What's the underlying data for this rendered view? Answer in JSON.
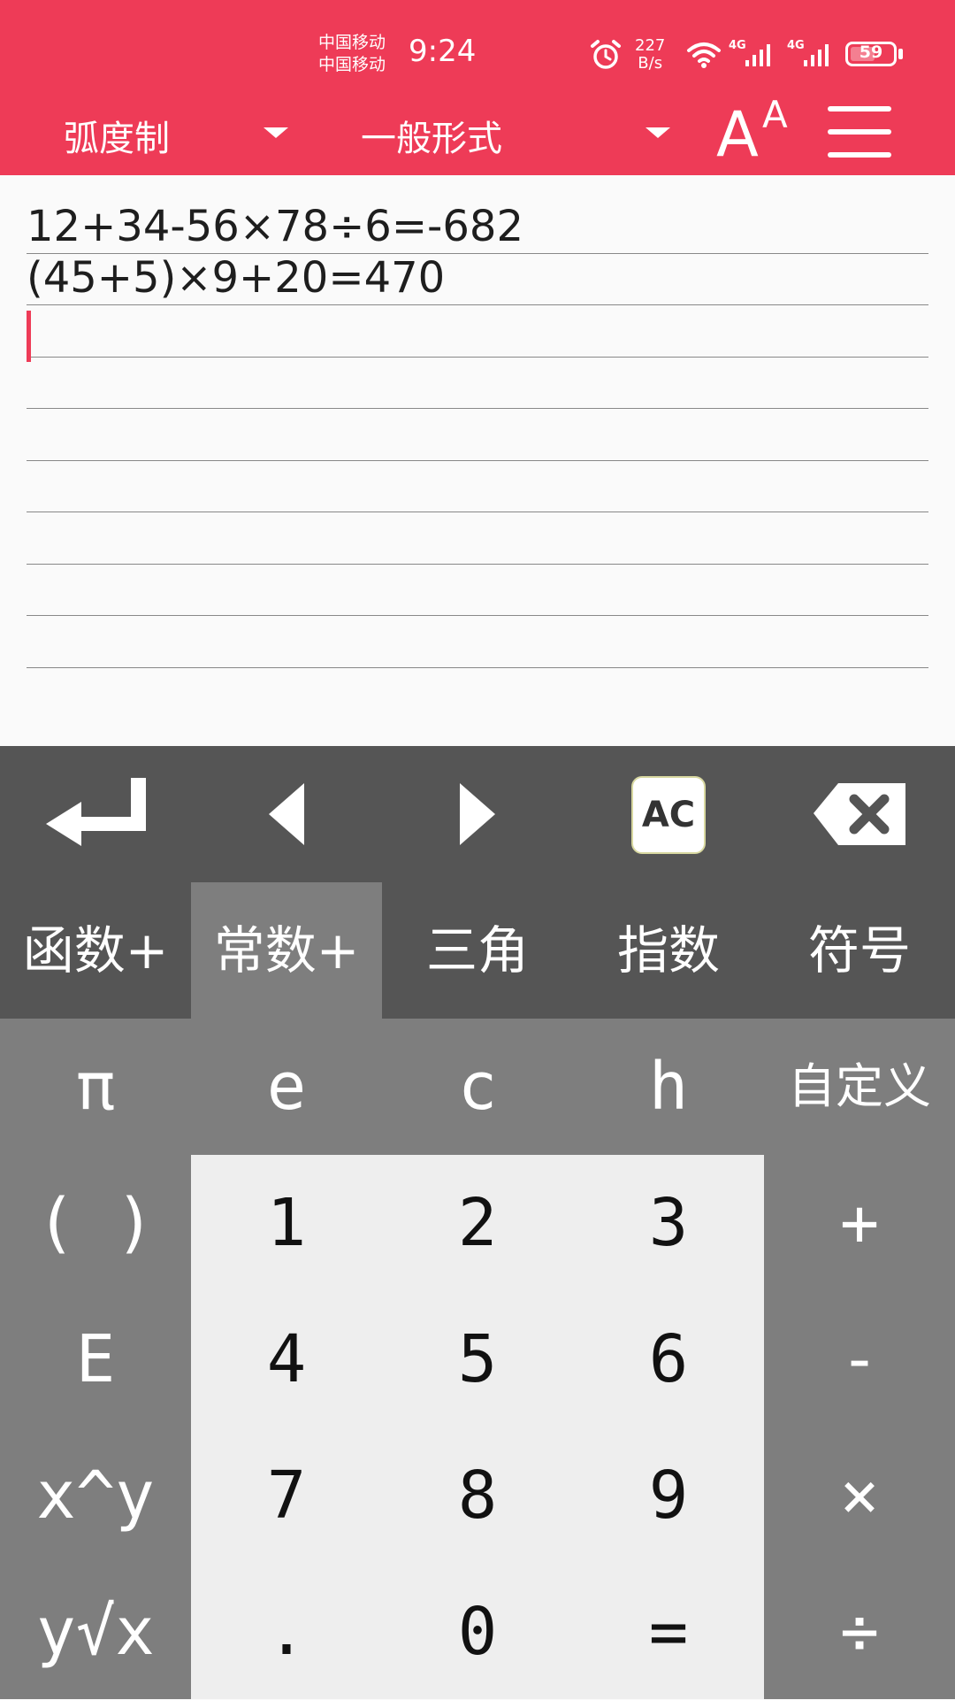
{
  "status_bar": {
    "carrier_1": "中国移动",
    "carrier_2": "中国移动",
    "time": "9:24",
    "speed_value": "227",
    "speed_unit": "B/s",
    "signal_1_label": "4G",
    "signal_2_label": "4G",
    "battery": "59",
    "battery_level": 0.59
  },
  "toolbar": {
    "angle_mode": "弧度制",
    "display_format": "一般形式",
    "font_size_icon": "font-size-icon",
    "menu_icon": "menu-icon"
  },
  "editor": {
    "lines": [
      "12+34-56×78÷6=-682",
      "(45+5)×9+20=470",
      "",
      "",
      "",
      "",
      "",
      "",
      "",
      ""
    ],
    "cursor_line": 2
  },
  "controls": {
    "enter_icon": "enter-icon",
    "left_icon": "arrow-left-icon",
    "right_icon": "arrow-right-icon",
    "clear_label": "AC",
    "backspace_icon": "backspace-icon"
  },
  "tabs": {
    "items": [
      "函数+",
      "常数+",
      "三角",
      "指数",
      "符号"
    ],
    "active": 1
  },
  "keypad": {
    "row1": [
      "π",
      "e",
      "c",
      "h",
      "自定义"
    ],
    "row2": [
      "( )",
      "1",
      "2",
      "3",
      "+"
    ],
    "row3": [
      "E",
      "4",
      "5",
      "6",
      "-"
    ],
    "row4": [
      "x^y",
      "7",
      "8",
      "9",
      "×"
    ],
    "row5": [
      "y√x",
      ".",
      "0",
      "=",
      "÷"
    ]
  },
  "colors": {
    "accent": "#ee3b57",
    "dark_panel": "#555555",
    "key_panel": "#7e7e7e",
    "numpad": "#eeeeee"
  }
}
